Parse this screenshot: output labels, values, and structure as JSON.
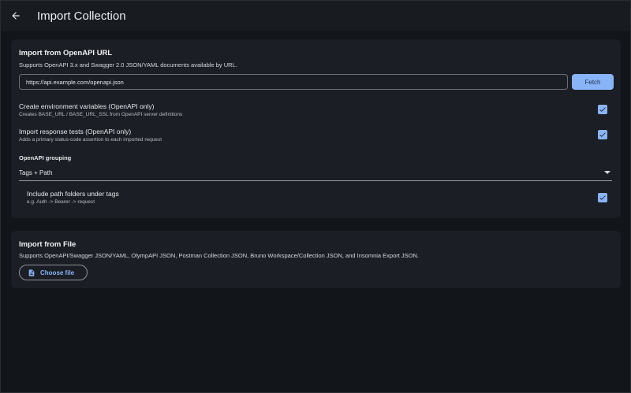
{
  "appbar": {
    "title": "Import Collection",
    "back_icon": "arrow-left-icon"
  },
  "url_import": {
    "title": "Import from OpenAPI URL",
    "subtitle": "Supports OpenAPI 3.x and Swagger 2.0 JSON/YAML documents available by URL.",
    "url_value": "https://api.example.com/openapi.json",
    "fetch_label": "Fetch",
    "options": [
      {
        "label": "Create environment variables (OpenAPI only)",
        "hint": "Creates BASE_URL / BASE_URL_SSL from OpenAPI server definitions",
        "checked": true
      },
      {
        "label": "Import response tests (OpenAPI only)",
        "hint": "Adds a primary status-code assertion to each imported request",
        "checked": true
      }
    ],
    "grouping_label": "OpenAPI grouping",
    "grouping_value": "Tags + Path",
    "subfolder_option": {
      "label": "Include path folders under tags",
      "hint": "e.g. Auth -> Bearer -> request",
      "checked": true
    }
  },
  "file_import": {
    "title": "Import from File",
    "subtitle": "Supports OpenAPI/Swagger JSON/YAML, OlympAPI JSON, Postman Collection JSON, Bruno Workspace/Collection JSON, and Insomnia Export JSON.",
    "choose_label": "Choose file",
    "choose_icon": "file-icon"
  },
  "colors": {
    "accent": "#8ab4f8",
    "background": "#12151a",
    "card": "#1b1e24"
  }
}
